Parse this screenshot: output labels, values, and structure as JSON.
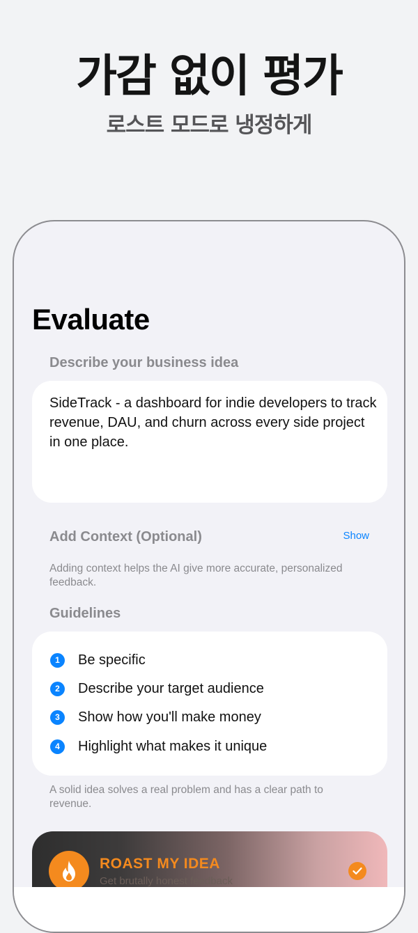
{
  "hero": {
    "title": "가감 없이 평가",
    "subtitle": "로스트 모드로 냉정하게"
  },
  "screen": {
    "title": "Evaluate",
    "idea_label": "Describe your business idea",
    "idea_text": "SideTrack - a dashboard for indie developers to track revenue, DAU, and churn across every side project in one place.",
    "context_label": "Add Context (Optional)",
    "context_toggle": "Show",
    "context_note": "Adding context helps the AI give more accurate, personalized feedback.",
    "guidelines_label": "Guidelines",
    "guidelines": [
      {
        "num": "1",
        "text": "Be specific"
      },
      {
        "num": "2",
        "text": "Describe your target audience"
      },
      {
        "num": "3",
        "text": "Show how you'll make money"
      },
      {
        "num": "4",
        "text": "Highlight what makes it unique"
      }
    ],
    "guidelines_note": "A solid idea solves a real problem and has a clear path to revenue.",
    "roast": {
      "title": "ROAST MY IDEA",
      "subtitle": "Get brutally honest feedback",
      "icon": "flame-icon",
      "selected_icon": "checkmark-icon"
    }
  },
  "colors": {
    "accent": "#0a84ff",
    "roast_orange": "#f48a1e"
  }
}
